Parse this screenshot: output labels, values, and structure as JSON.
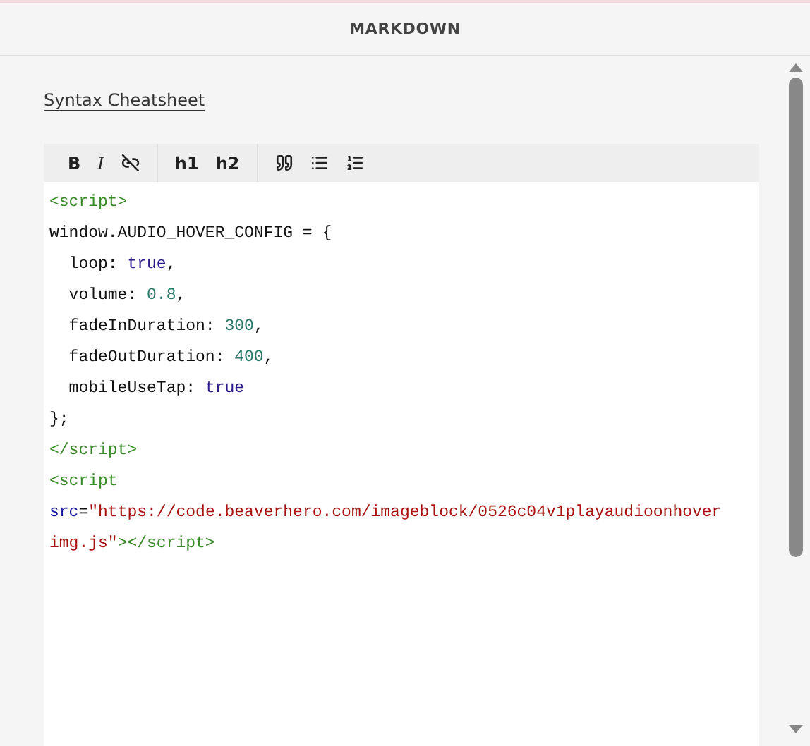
{
  "header": {
    "title": "MARKDOWN"
  },
  "link": {
    "label": "Syntax Cheatsheet"
  },
  "toolbar": {
    "groups": [
      [
        {
          "kind": "bold",
          "label": "B"
        },
        {
          "kind": "italic",
          "label": "I"
        },
        {
          "kind": "unlink"
        }
      ],
      [
        {
          "kind": "heading",
          "label": "h1"
        },
        {
          "kind": "heading",
          "label": "h2"
        }
      ],
      [
        {
          "kind": "quote"
        },
        {
          "kind": "bullets"
        },
        {
          "kind": "numbers"
        }
      ]
    ]
  },
  "code_lines": [
    [
      {
        "kind": "tag",
        "text": "<script>"
      }
    ],
    [
      {
        "kind": "plain",
        "text": "window.AUDIO_HOVER_CONFIG = {"
      }
    ],
    [
      {
        "kind": "plain",
        "text": "  loop: "
      },
      {
        "kind": "keyword",
        "text": "true"
      },
      {
        "kind": "plain",
        "text": ","
      }
    ],
    [
      {
        "kind": "plain",
        "text": "  volume: "
      },
      {
        "kind": "number",
        "text": "0.8"
      },
      {
        "kind": "plain",
        "text": ","
      }
    ],
    [
      {
        "kind": "plain",
        "text": "  fadeInDuration: "
      },
      {
        "kind": "number",
        "text": "300"
      },
      {
        "kind": "plain",
        "text": ","
      }
    ],
    [
      {
        "kind": "plain",
        "text": "  fadeOutDuration: "
      },
      {
        "kind": "number",
        "text": "400"
      },
      {
        "kind": "plain",
        "text": ","
      }
    ],
    [
      {
        "kind": "plain",
        "text": "  mobileUseTap: "
      },
      {
        "kind": "keyword",
        "text": "true"
      }
    ],
    [
      {
        "kind": "plain",
        "text": "};"
      }
    ],
    [
      {
        "kind": "tag",
        "text": "</script>"
      }
    ],
    [
      {
        "kind": "tag",
        "text": "<script"
      }
    ],
    [
      {
        "kind": "attr",
        "text": "src"
      },
      {
        "kind": "plain",
        "text": "="
      },
      {
        "kind": "string",
        "text": "\"https://code.beaverhero.com/imageblock/0526c04v1playaudioonhover"
      }
    ],
    [
      {
        "kind": "string",
        "text": "img.js\""
      },
      {
        "kind": "tag",
        "text": "></script>"
      }
    ]
  ]
}
